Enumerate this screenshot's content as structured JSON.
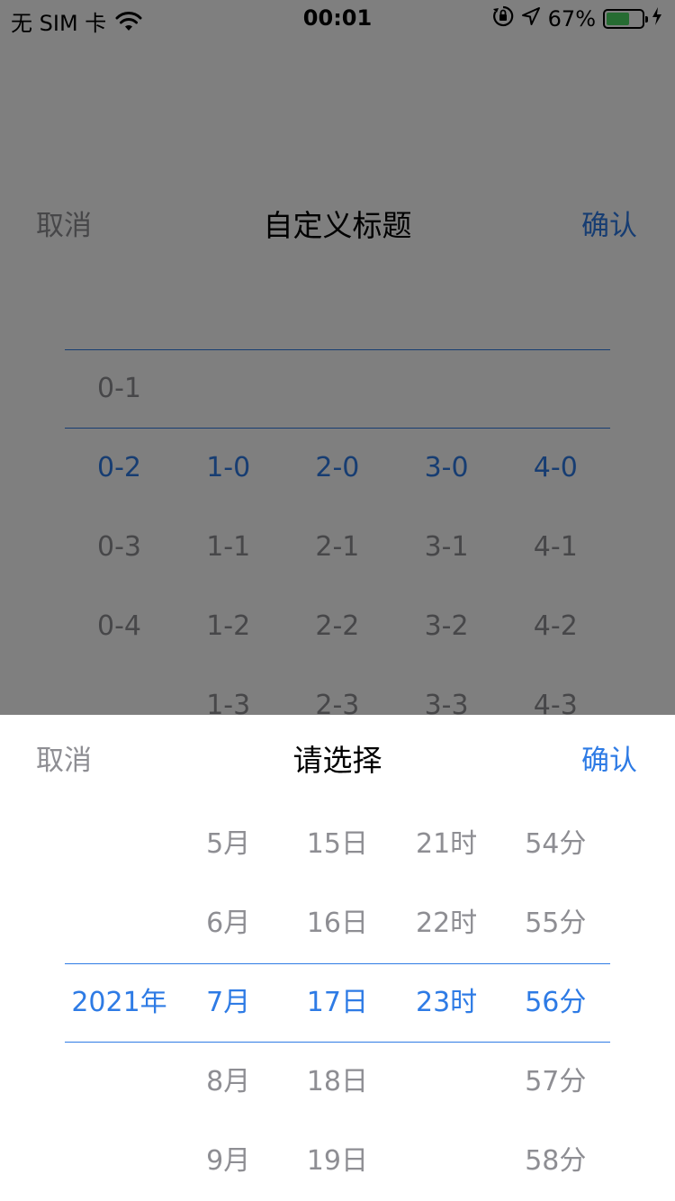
{
  "status_bar": {
    "carrier": "无 SIM 卡",
    "time": "00:01",
    "battery_percent": "67%",
    "battery_level": 0.67,
    "icons": [
      "wifi-icon",
      "orientation-lock-icon",
      "location-icon",
      "battery-icon",
      "charging-icon"
    ]
  },
  "bg_dialog": {
    "cancel": "取消",
    "title": "自定义标题",
    "confirm": "确认",
    "columns": [
      [
        "0-1",
        "0-2",
        "0-3",
        "0-4"
      ],
      [
        "1-0",
        "1-1",
        "1-2",
        "1-3"
      ],
      [
        "2-0",
        "2-1",
        "2-2",
        "2-3"
      ],
      [
        "3-0",
        "3-1",
        "3-2",
        "3-3"
      ],
      [
        "4-0",
        "4-1",
        "4-2",
        "4-3"
      ]
    ],
    "selected": [
      "0-2",
      "1-0",
      "2-0",
      "3-0",
      "4-0"
    ]
  },
  "sheet": {
    "cancel": "取消",
    "title": "请选择",
    "confirm": "确认",
    "columns": [
      [
        "2021年"
      ],
      [
        "5月",
        "6月",
        "7月",
        "8月",
        "9月"
      ],
      [
        "15日",
        "16日",
        "17日",
        "18日",
        "19日"
      ],
      [
        "21时",
        "22时",
        "23时"
      ],
      [
        "54分",
        "55分",
        "56分",
        "57分",
        "58分"
      ]
    ],
    "selected": [
      "2021年",
      "7月",
      "17日",
      "23时",
      "56分"
    ]
  },
  "colors": {
    "accent": "#2e7be5",
    "muted": "#8e8e93",
    "battery": "#4cd964",
    "overlay": "rgba(0,0,0,0.5)"
  }
}
